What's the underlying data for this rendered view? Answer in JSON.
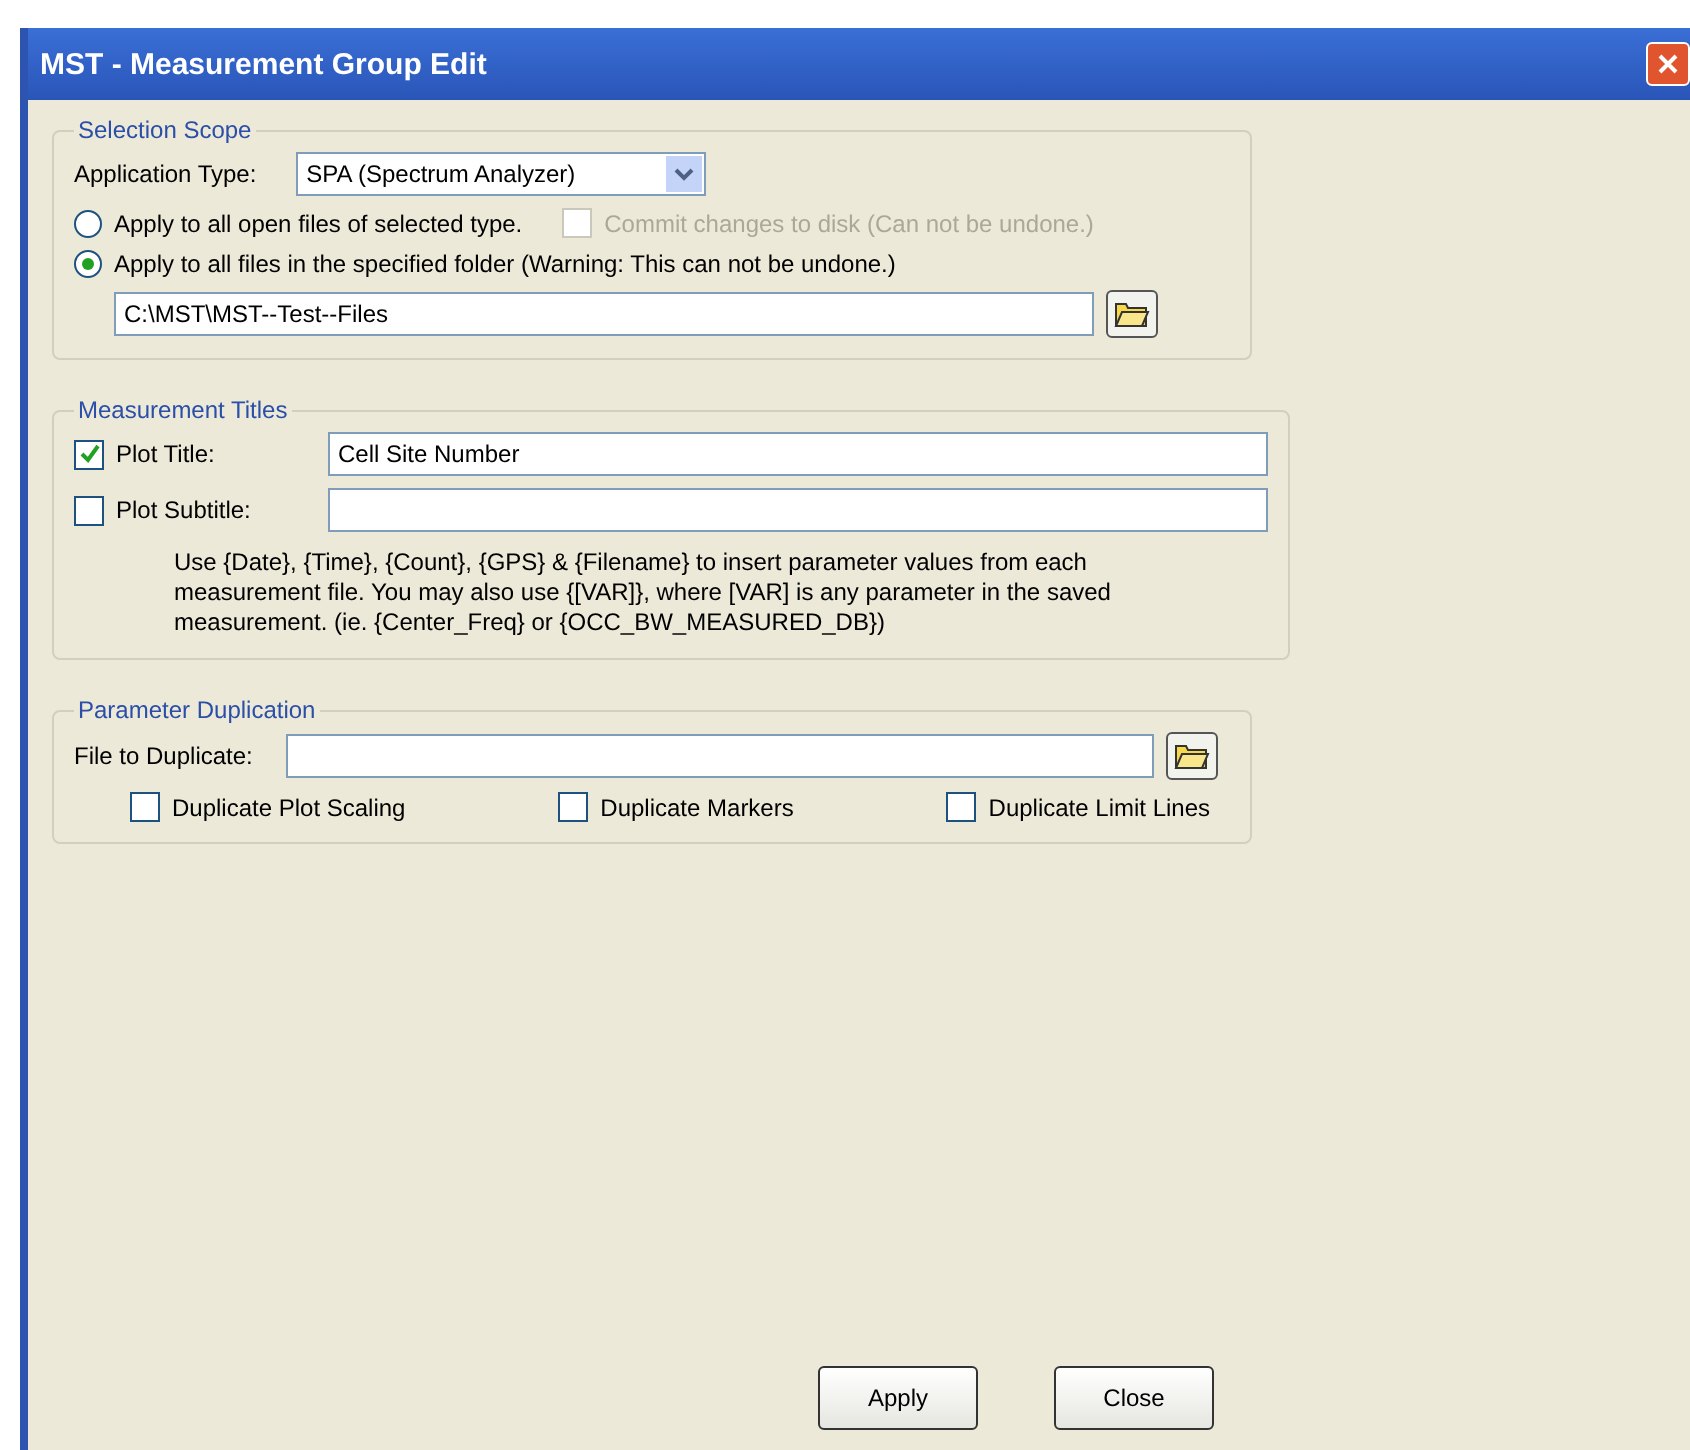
{
  "window": {
    "title": "MST - Measurement Group Edit"
  },
  "selection_scope": {
    "legend": "Selection Scope",
    "application_type_label": "Application Type:",
    "application_type": "SPA (Spectrum Analyzer)",
    "options": [
      {
        "label": "Apply to all open files of selected type.",
        "selected": false
      },
      {
        "label": "Apply to all files in the specified folder (Warning: This can not be undone.)",
        "selected": true
      }
    ],
    "commit": {
      "label": "Commit changes to disk (Can not be undone.)",
      "checked": false,
      "disabled": true
    },
    "folder": "C:\\MST\\MST--Test--Files"
  },
  "measurement_titles": {
    "legend": "Measurement Titles",
    "fields": [
      {
        "label": "Plot Title:",
        "checked": true,
        "value": "Cell Site Number"
      },
      {
        "label": "Plot Subtitle:",
        "checked": false
      }
    ],
    "help": "Use {Date}, {Time}, {Count}, {GPS} & {Filename} to insert parameter values from each measurement file.  You may also use {[VAR]}, where [VAR] is any parameter in the saved measurement. (ie. {Center_Freq} or {OCC_BW_MEASURED_DB})"
  },
  "parameter_duplication": {
    "legend": "Parameter Duplication",
    "file_label": "File to Duplicate:",
    "options": [
      {
        "label": "Duplicate Plot Scaling",
        "checked": false
      },
      {
        "label": "Duplicate Markers",
        "checked": false
      },
      {
        "label": "Duplicate Limit Lines",
        "checked": false
      }
    ]
  },
  "buttons": [
    "Apply",
    "Close"
  ]
}
